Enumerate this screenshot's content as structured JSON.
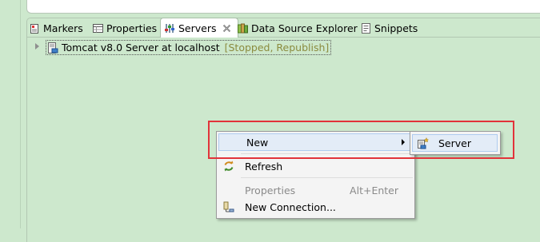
{
  "tabs": [
    {
      "label": "Markers",
      "icon": "markers-icon"
    },
    {
      "label": "Properties",
      "icon": "properties-icon"
    },
    {
      "label": "Servers",
      "icon": "servers-icon",
      "active": true,
      "closable": true
    },
    {
      "label": "Data Source Explorer",
      "icon": "data-source-explorer-icon"
    },
    {
      "label": "Snippets",
      "icon": "snippets-icon"
    }
  ],
  "servers": {
    "row": {
      "name": "Tomcat v8.0 Server at localhost",
      "status": "[Stopped, Republish]",
      "icon": "tomcat-server-icon"
    }
  },
  "context_menu": {
    "items": [
      {
        "label": "New",
        "has_submenu": true
      },
      {
        "label": "Refresh",
        "icon": "refresh-icon"
      },
      {
        "label": "Properties",
        "shortcut": "Alt+Enter",
        "disabled": true
      },
      {
        "label": "New Connection...",
        "icon": "new-connection-icon"
      }
    ],
    "submenu": {
      "label": "Server",
      "icon": "new-server-icon"
    }
  },
  "colors": {
    "background": "#cde8cd",
    "highlight_annotation": "#e2333a",
    "menu_hover": "#e3ecf7"
  }
}
